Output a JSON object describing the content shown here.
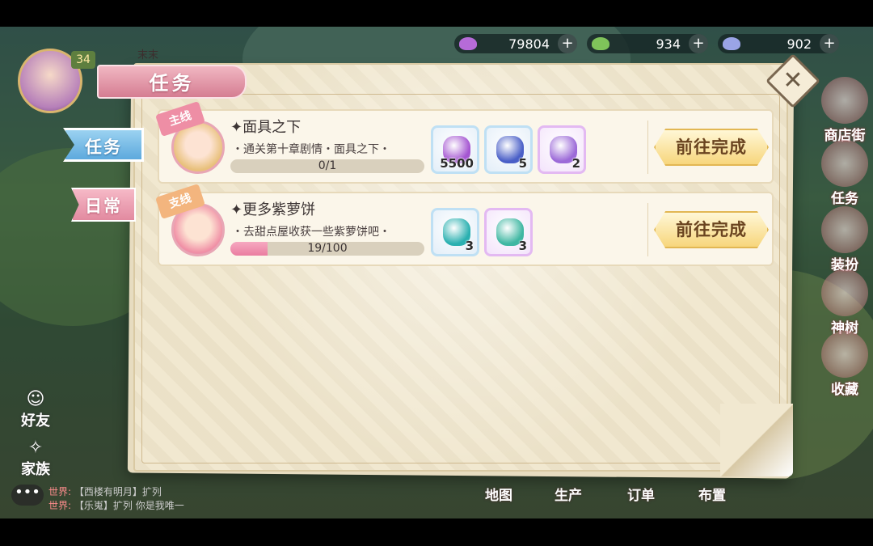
{
  "resources": [
    {
      "name": "purple-gem",
      "value": "79804",
      "color": "#b66bd8"
    },
    {
      "name": "green-leaf",
      "value": "934",
      "color": "#7fc35a"
    },
    {
      "name": "crystal",
      "value": "902",
      "color": "#9aa4e6"
    }
  ],
  "player": {
    "level": "34",
    "name": "末末"
  },
  "panel": {
    "title": "任务"
  },
  "tabs": {
    "task": "任务",
    "daily": "日常"
  },
  "quests": [
    {
      "tag": "主线",
      "title": "✦面具之下",
      "desc": "・通关第十章剧情・面具之下・",
      "progress_text": "0/1",
      "progress": 0.0,
      "rewards": [
        {
          "icon": "purple-candy-icon",
          "count": "5500",
          "color": "#a455d1"
        },
        {
          "icon": "blue-crystal-icon",
          "count": "5",
          "color": "#4a5fc7"
        },
        {
          "icon": "potion-bottle-icon",
          "count": "2",
          "color": "#9c6ad8"
        }
      ],
      "button": "前往完成"
    },
    {
      "tag": "支线",
      "title": "✦更多紫萝饼",
      "desc": "・去甜点屋收获一些紫萝饼吧・",
      "progress_text": "19/100",
      "progress": 0.19,
      "rewards": [
        {
          "icon": "teal-gem-icon",
          "count": "3",
          "color": "#2ab0b0"
        },
        {
          "icon": "green-emblem-icon",
          "count": "3",
          "color": "#3fb7a2"
        }
      ],
      "button": "前往完成"
    }
  ],
  "right_menu": [
    "商店街",
    "任务",
    "装扮",
    "神树",
    "收藏"
  ],
  "left_menu": [
    "好友",
    "家族"
  ],
  "bottom_nav": [
    "地图",
    "生产",
    "订单",
    "布置"
  ],
  "chat": [
    {
      "channel": "世界:",
      "text": "【西楼有明月】扩列"
    },
    {
      "channel": "世界:",
      "text": "【乐嵬】扩列 你是我唯一"
    }
  ],
  "chat_button": "•••"
}
